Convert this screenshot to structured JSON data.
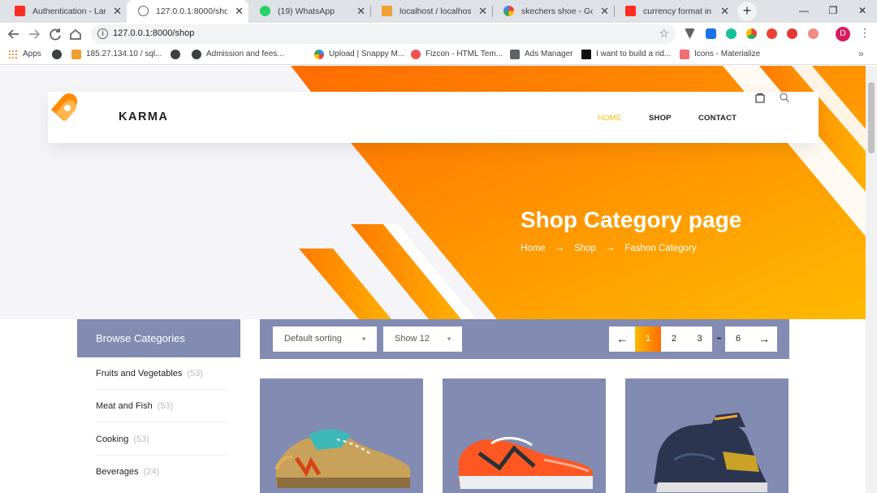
{
  "browser": {
    "tabs": [
      {
        "title": "Authentication - Larave",
        "favicon_color": "#ff2d20"
      },
      {
        "title": "127.0.0.1:8000/shop",
        "favicon_color": "#5f6368"
      },
      {
        "title": "(19) WhatsApp",
        "favicon_color": "#25d366"
      },
      {
        "title": "localhost / localhost / e",
        "favicon_color": "#f0a030"
      },
      {
        "title": "skechers shoe - Google",
        "favicon_color": "#4285f4"
      },
      {
        "title": "currency format in lara",
        "favicon_color": "#ff2d20"
      }
    ],
    "active_tab_index": 1,
    "url": "127.0.0.1:8000/shop",
    "profile_initial": "D",
    "window_controls": {
      "minimize": "—",
      "maximize": "❐",
      "close": "✕"
    },
    "icons": [
      "back-arrow-icon",
      "forward-arrow-icon",
      "reload-icon",
      "home-icon",
      "site-info-icon",
      "bookmark-star-icon",
      "kebab-menu-icon"
    ]
  },
  "bookmarks": [
    {
      "label": "Apps",
      "icon": "apps-grid-icon"
    },
    {
      "label": "185.27.134.10 / sql...",
      "icon": "phpmyadmin-icon"
    },
    {
      "label": "",
      "icon": "globe-icon"
    },
    {
      "label": "",
      "icon": "globe-icon"
    },
    {
      "label": "Admission and fees...",
      "icon": "globe-icon"
    },
    {
      "label": "Upload | Snappy M...",
      "icon": "snappy-icon"
    },
    {
      "label": "Fizcon - HTML Tem...",
      "icon": "fizcon-icon"
    },
    {
      "label": "Ads Manager",
      "icon": "ads-manager-icon"
    },
    {
      "label": "I want to build a rid...",
      "icon": "medium-icon"
    },
    {
      "label": "Icons - Materialize",
      "icon": "materialize-icon"
    }
  ],
  "site": {
    "brand": "KARMA",
    "nav": [
      {
        "label": "HOME",
        "active": true
      },
      {
        "label": "SHOP",
        "active": false
      },
      {
        "label": "CONTACT",
        "active": false
      }
    ],
    "accent": "#ffba00",
    "accent_dark": "#ff6c00"
  },
  "hero": {
    "title": "Shop Category page",
    "breadcrumb": [
      "Home",
      "Shop",
      "Fashon Category"
    ],
    "breadcrumb_separator": "→"
  },
  "sidebar": {
    "heading": "Browse Categories",
    "items": [
      {
        "label": "Fruits and Vegetables",
        "count": "(53)"
      },
      {
        "label": "Meat and Fish",
        "count": "(53)"
      },
      {
        "label": "Cooking",
        "count": "(53)"
      },
      {
        "label": "Beverages",
        "count": "(24)"
      }
    ]
  },
  "filters": {
    "sorting": "Default sorting",
    "show": "Show 12",
    "pagination": {
      "prev": "←",
      "pages": [
        "1",
        "2",
        "3"
      ],
      "ellipsis": "•••",
      "last": "6",
      "next": "→",
      "current": "1"
    }
  },
  "products": [
    {
      "name": "tan-suede-sneaker"
    },
    {
      "name": "orange-running-shoe"
    },
    {
      "name": "navy-gold-high-top"
    }
  ]
}
